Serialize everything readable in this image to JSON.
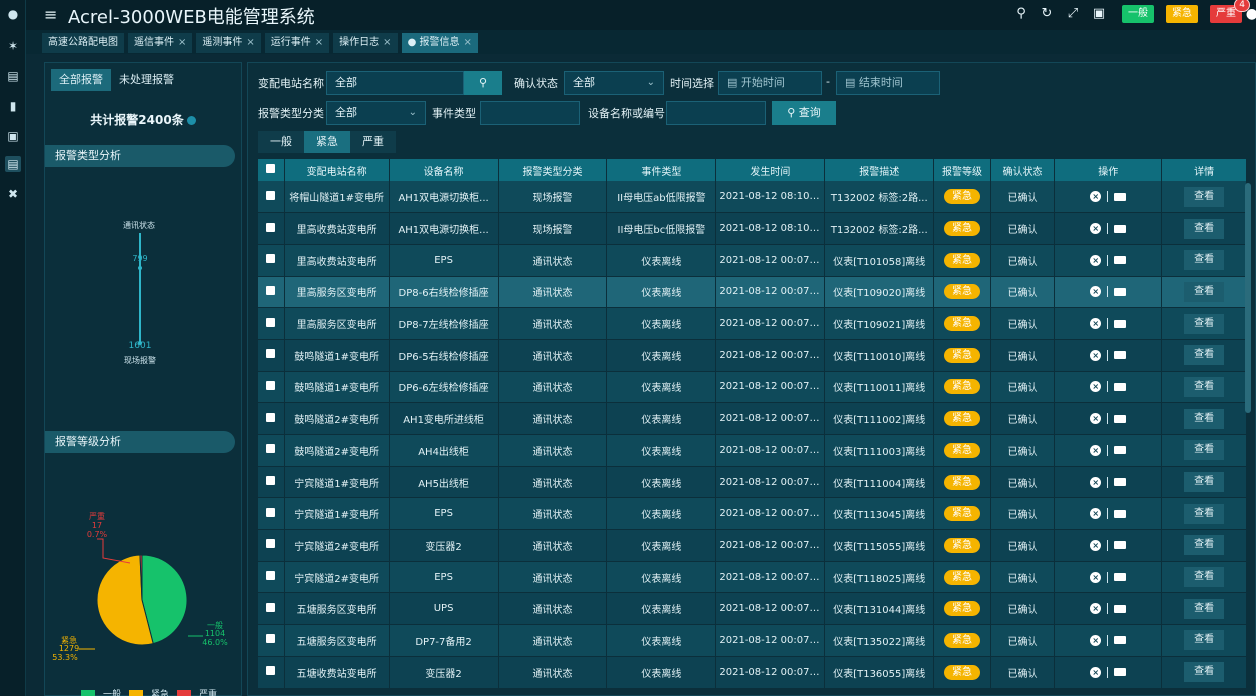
{
  "header": {
    "title": "Acrel-3000WEB电能管理系统",
    "levels": {
      "general": "一般",
      "urgent": "紧急",
      "severe": "严重",
      "severe_count": "4"
    }
  },
  "tabs": [
    {
      "label": "高速公路配电图",
      "closable": false
    },
    {
      "label": "遥信事件",
      "closable": true
    },
    {
      "label": "遥测事件",
      "closable": true
    },
    {
      "label": "运行事件",
      "closable": true
    },
    {
      "label": "操作日志",
      "closable": true
    },
    {
      "label": "● 报警信息",
      "closable": true,
      "active": true
    }
  ],
  "left": {
    "tab_all": "全部报警",
    "tab_unhandled": "未处理报警",
    "total": "共计报警2400条",
    "type_section": "报警类型分析",
    "type_chart": {
      "top_label": "通讯状态",
      "top_value": "799",
      "bottom_value": "1601",
      "bottom_label": "现场报警"
    },
    "level_section": "报警等级分析",
    "pie": {
      "severe": {
        "label": "严重",
        "value": "17",
        "pct": "0.7%"
      },
      "urgent": {
        "label": "紧急",
        "value": "1279",
        "pct": "53.3%"
      },
      "general": {
        "label": "一般",
        "value": "1104",
        "pct": "46.0%"
      },
      "legend": [
        "一般",
        "紧急",
        "严重"
      ],
      "colors": {
        "general": "#16c26b",
        "urgent": "#f5b400",
        "severe": "#e53b3b"
      }
    }
  },
  "chart_data": {
    "type": "pie",
    "title": "报警等级分析",
    "categories": [
      "一般",
      "紧急",
      "严重"
    ],
    "values": [
      1104,
      1279,
      17
    ],
    "percent": [
      46.0,
      53.3,
      0.7
    ]
  },
  "filters": {
    "station_label": "变配电站名称",
    "station_value": "全部",
    "confirm_label": "确认状态",
    "confirm_value": "全部",
    "time_label": "时间选择",
    "start_placeholder": "开始时间",
    "end_placeholder": "结束时间",
    "type_label": "报警类型分类",
    "type_value": "全部",
    "event_label": "事件类型",
    "device_label": "设备名称或编号",
    "query_label": "查询"
  },
  "level_tabs": [
    "一般",
    "紧急",
    "严重"
  ],
  "table": {
    "columns": [
      "变配电站名称",
      "设备名称",
      "报警类型分类",
      "事件类型",
      "发生时间",
      "报警描述",
      "报警等级",
      "确认状态",
      "操作",
      "详情"
    ],
    "rows": [
      [
        "将帽山隧道1#变电所",
        "AH1双电源切换柜...",
        "现场报警",
        "II母电压ab低限报警",
        "2021-08-12 08:10:18",
        "T132002 标签:2路...",
        "紧急",
        "已确认",
        "查看"
      ],
      [
        "里高收费站变电所",
        "AH1双电源切换柜...",
        "现场报警",
        "II母电压bc低限报警",
        "2021-08-12 08:10:18",
        "T132002 标签:2路...",
        "紧急",
        "已确认",
        "查看"
      ],
      [
        "里高收费站变电所",
        "EPS",
        "通讯状态",
        "仪表离线",
        "2021-08-12 00:07:16",
        "仪表[T101058]离线",
        "紧急",
        "已确认",
        "查看"
      ],
      [
        "里高服务区变电所",
        "DP8-6右线检修插座",
        "通讯状态",
        "仪表离线",
        "2021-08-12 00:07:16",
        "仪表[T109020]离线",
        "紧急",
        "已确认",
        "查看"
      ],
      [
        "里高服务区变电所",
        "DP8-7左线检修插座",
        "通讯状态",
        "仪表离线",
        "2021-08-12 00:07:16",
        "仪表[T109021]离线",
        "紧急",
        "已确认",
        "查看"
      ],
      [
        "鼓鸣隧道1#变电所",
        "DP6-5右线检修插座",
        "通讯状态",
        "仪表离线",
        "2021-08-12 00:07:16",
        "仪表[T110010]离线",
        "紧急",
        "已确认",
        "查看"
      ],
      [
        "鼓鸣隧道1#变电所",
        "DP6-6左线检修插座",
        "通讯状态",
        "仪表离线",
        "2021-08-12 00:07:16",
        "仪表[T110011]离线",
        "紧急",
        "已确认",
        "查看"
      ],
      [
        "鼓鸣隧道2#变电所",
        "AH1变电所进线柜",
        "通讯状态",
        "仪表离线",
        "2021-08-12 00:07:16",
        "仪表[T111002]离线",
        "紧急",
        "已确认",
        "查看"
      ],
      [
        "鼓鸣隧道2#变电所",
        "AH4出线柜",
        "通讯状态",
        "仪表离线",
        "2021-08-12 00:07:16",
        "仪表[T111003]离线",
        "紧急",
        "已确认",
        "查看"
      ],
      [
        "宁宾隧道1#变电所",
        "AH5出线柜",
        "通讯状态",
        "仪表离线",
        "2021-08-12 00:07:16",
        "仪表[T111004]离线",
        "紧急",
        "已确认",
        "查看"
      ],
      [
        "宁宾隧道1#变电所",
        "EPS",
        "通讯状态",
        "仪表离线",
        "2021-08-12 00:07:16",
        "仪表[T113045]离线",
        "紧急",
        "已确认",
        "查看"
      ],
      [
        "宁宾隧道2#变电所",
        "变压器2",
        "通讯状态",
        "仪表离线",
        "2021-08-12 00:07:16",
        "仪表[T115055]离线",
        "紧急",
        "已确认",
        "查看"
      ],
      [
        "宁宾隧道2#变电所",
        "EPS",
        "通讯状态",
        "仪表离线",
        "2021-08-12 00:07:16",
        "仪表[T118025]离线",
        "紧急",
        "已确认",
        "查看"
      ],
      [
        "五塘服务区变电所",
        "UPS",
        "通讯状态",
        "仪表离线",
        "2021-08-12 00:07:16",
        "仪表[T131044]离线",
        "紧急",
        "已确认",
        "查看"
      ],
      [
        "五塘服务区变电所",
        "DP7-7备用2",
        "通讯状态",
        "仪表离线",
        "2021-08-12 00:07:16",
        "仪表[T135022]离线",
        "紧急",
        "已确认",
        "查看"
      ],
      [
        "五塘收费站变电所",
        "变压器2",
        "通讯状态",
        "仪表离线",
        "2021-08-12 00:07:16",
        "仪表[T136055]离线",
        "紧急",
        "已确认",
        "查看"
      ]
    ]
  }
}
